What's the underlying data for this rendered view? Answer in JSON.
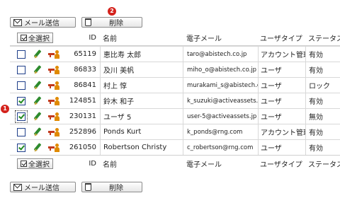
{
  "toolbar": {
    "send_mail_label": "メール送信",
    "delete_label": "削除"
  },
  "callouts": {
    "delete_marker": "2",
    "checkbox_marker": "1"
  },
  "table": {
    "select_all_label": "全選択",
    "headers": {
      "id": "ID",
      "name": "名前",
      "email": "電子メール",
      "user_type": "ユーザタイプ",
      "status": "ステータス"
    },
    "rows": [
      {
        "checked": false,
        "id": "65119",
        "name": "恵比寿 太郎",
        "email": "taro@abistech.co.jp",
        "user_type": "アカウント管理者",
        "status": "有効"
      },
      {
        "checked": false,
        "id": "86833",
        "name": "及川 美帆",
        "email": "miho_o@abistech.co.jp",
        "user_type": "ユーザ",
        "status": "有効"
      },
      {
        "checked": false,
        "id": "86841",
        "name": "村上 惇",
        "email": "murakami_s@abistech.co.jp",
        "user_type": "ユーザ",
        "status": "ロック"
      },
      {
        "checked": true,
        "id": "124851",
        "name": "鈴木 和子",
        "email": "k_suzuki@activeassets.jp",
        "user_type": "ユーザ",
        "status": "有効"
      },
      {
        "checked": true,
        "id": "230131",
        "name": "ユーザ 5",
        "email": "user-5@activeassets.jp",
        "user_type": "ユーザ",
        "status": "無効"
      },
      {
        "checked": false,
        "id": "252896",
        "name": "Ponds Kurt",
        "email": "k_ponds@rng.com",
        "user_type": "アカウント管理者",
        "status": "有効"
      },
      {
        "checked": true,
        "id": "261050",
        "name": "Robertson Christy",
        "email": "c_robertson@rng.com",
        "user_type": "ユーザ",
        "status": "有効"
      }
    ]
  },
  "colors": {
    "callout": "#d4221c",
    "checkmark": "#228b22",
    "pencil": "#2e8b2e",
    "user_icon": "#e08a00"
  },
  "icons": {
    "mail": "mail-icon",
    "trash": "trash-icon",
    "edit": "pencil-icon",
    "permission": "key-user-icon"
  }
}
